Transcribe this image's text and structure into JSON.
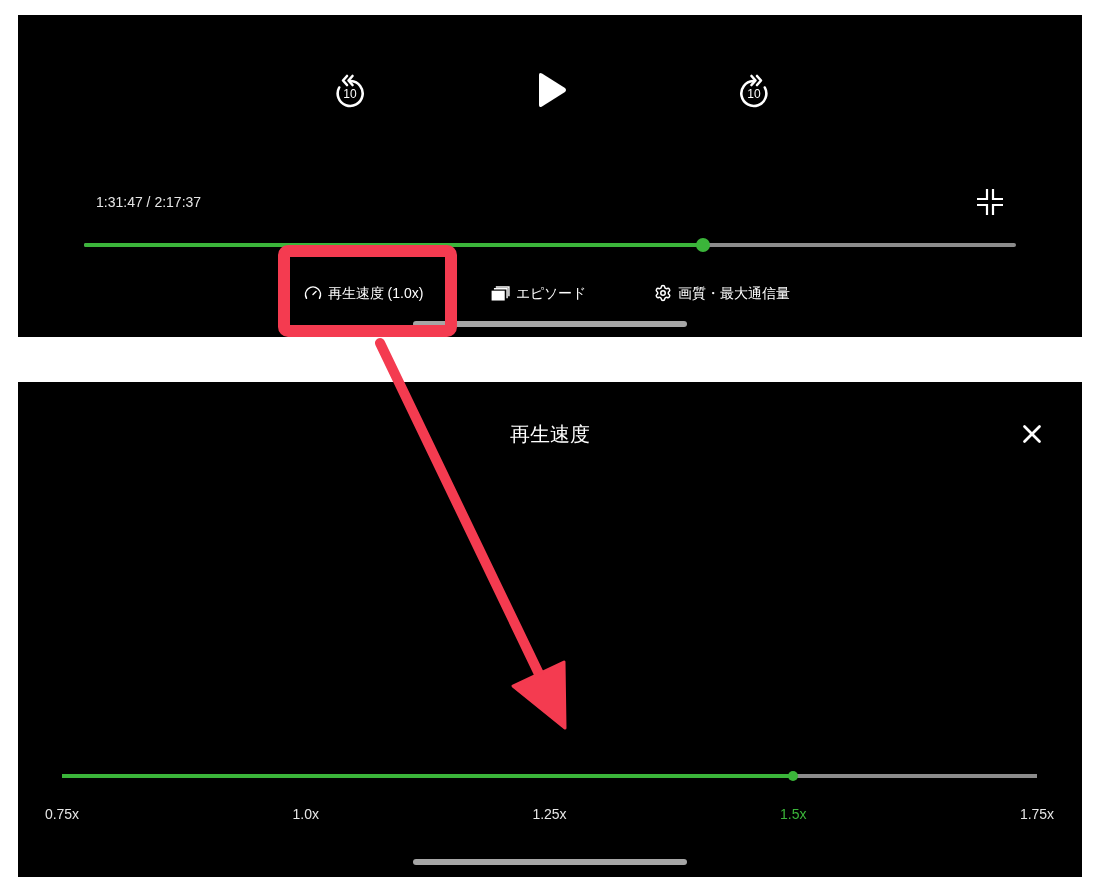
{
  "player": {
    "controls": [
      {
        "kind": "rewind",
        "label": "10"
      },
      {
        "kind": "play"
      },
      {
        "kind": "forward",
        "label": "10"
      }
    ],
    "time": "1:31:47 / 2:17:37",
    "progress": {
      "level": 0.664
    },
    "menu": [
      {
        "kind": "speed",
        "label": "再生速度 (1.0x)",
        "highlighted": true
      },
      {
        "kind": "episodes",
        "label": "エピソード",
        "highlighted": false
      },
      {
        "kind": "quality",
        "label": "画質・最大通信量",
        "highlighted": false
      }
    ]
  },
  "annotations": [
    {
      "kind": "arrow"
    }
  ],
  "speed_panel": {
    "title": "再生速度",
    "slider": {
      "level": 0.75
    },
    "options": [
      {
        "label": "0.75x",
        "selected": false
      },
      {
        "label": "1.0x",
        "selected": false
      },
      {
        "label": "1.25x",
        "selected": false
      },
      {
        "label": "1.5x",
        "selected": true
      },
      {
        "label": "1.75x",
        "selected": false
      }
    ]
  }
}
